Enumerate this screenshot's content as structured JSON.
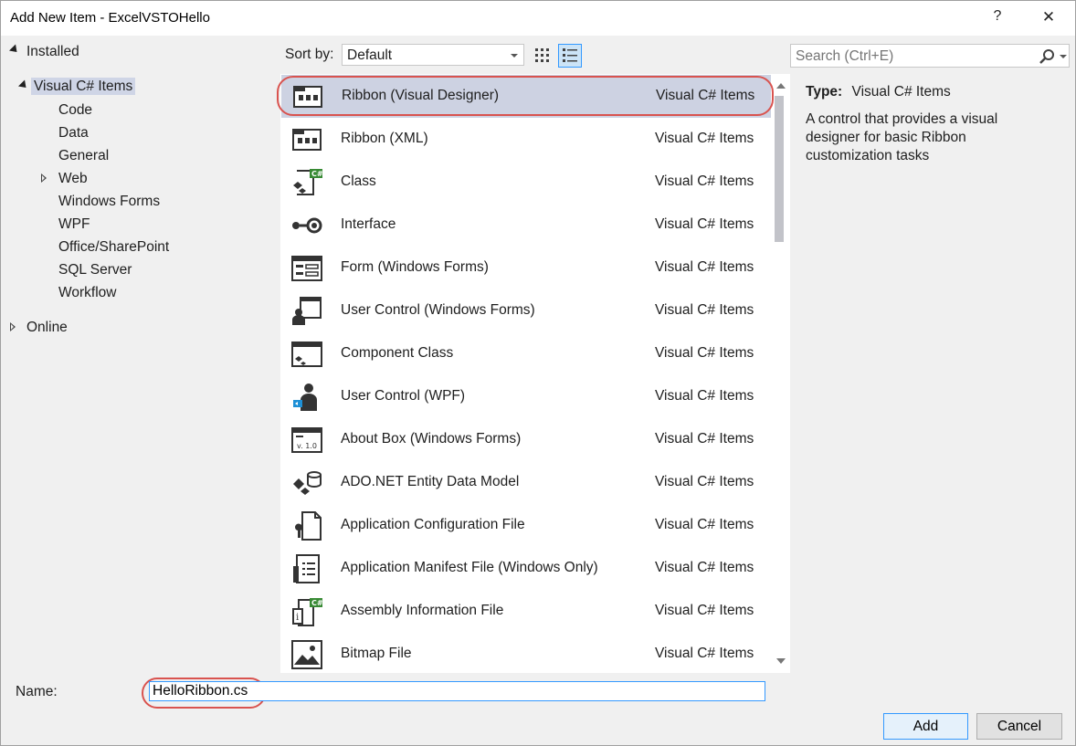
{
  "window": {
    "title": "Add New Item - ExcelVSTOHello",
    "help_label": "?",
    "close_label": "✕"
  },
  "tree": {
    "installed": "Installed",
    "visual_csharp_items": "Visual C# Items",
    "children": [
      "Code",
      "Data",
      "General",
      "Web",
      "Windows Forms",
      "WPF",
      "Office/SharePoint",
      "SQL Server",
      "Workflow"
    ],
    "online": "Online"
  },
  "toolbar": {
    "sort_label": "Sort by:",
    "sort_value": "Default"
  },
  "search": {
    "placeholder": "Search (Ctrl+E)"
  },
  "items": [
    {
      "name": "Ribbon (Visual Designer)",
      "category": "Visual C# Items",
      "icon": "ribbon-icon"
    },
    {
      "name": "Ribbon (XML)",
      "category": "Visual C# Items",
      "icon": "ribbon-xml-icon"
    },
    {
      "name": "Class",
      "category": "Visual C# Items",
      "icon": "class-icon"
    },
    {
      "name": "Interface",
      "category": "Visual C# Items",
      "icon": "interface-icon"
    },
    {
      "name": "Form (Windows Forms)",
      "category": "Visual C# Items",
      "icon": "form-icon"
    },
    {
      "name": "User Control (Windows Forms)",
      "category": "Visual C# Items",
      "icon": "user-control-icon"
    },
    {
      "name": "Component Class",
      "category": "Visual C# Items",
      "icon": "component-class-icon"
    },
    {
      "name": "User Control (WPF)",
      "category": "Visual C# Items",
      "icon": "wpf-user-control-icon"
    },
    {
      "name": "About Box (Windows Forms)",
      "category": "Visual C# Items",
      "icon": "about-box-icon"
    },
    {
      "name": "ADO.NET Entity Data Model",
      "category": "Visual C# Items",
      "icon": "entity-model-icon"
    },
    {
      "name": "Application Configuration File",
      "category": "Visual C# Items",
      "icon": "config-file-icon"
    },
    {
      "name": "Application Manifest File (Windows Only)",
      "category": "Visual C# Items",
      "icon": "manifest-file-icon"
    },
    {
      "name": "Assembly Information File",
      "category": "Visual C# Items",
      "icon": "assembly-info-icon"
    },
    {
      "name": "Bitmap File",
      "category": "Visual C# Items",
      "icon": "bitmap-file-icon"
    }
  ],
  "details": {
    "type_label": "Type:",
    "type_value": "Visual C# Items",
    "description": "A control that provides a visual designer for basic Ribbon customization tasks"
  },
  "footer": {
    "name_label": "Name:",
    "name_value": "HelloRibbon.cs",
    "add_label": "Add",
    "cancel_label": "Cancel"
  },
  "colors": {
    "selection": "#cdd2e2",
    "highlight_circle": "#d9534f",
    "accent": "#3399ff",
    "csharp_green": "#388a34"
  }
}
